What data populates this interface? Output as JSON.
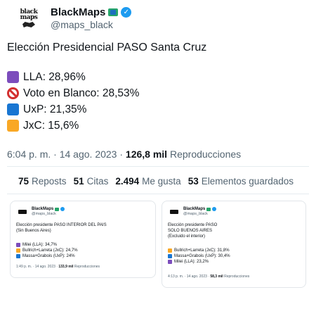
{
  "tweet": {
    "display_name": "BlackMaps",
    "handle": "@maps_black",
    "avatar_logo": "black maps",
    "title": "Elección Presidencial PASO Santa Cruz",
    "results": [
      {
        "label": "LLA: 28,96%",
        "color": "#7c4dbc",
        "icon": "purple-square-icon"
      },
      {
        "label": "Voto en Blanco: 28,53%",
        "color": "#d32f2f",
        "icon": "prohibited-icon"
      },
      {
        "label": "UxP: 21,35%",
        "color": "#1976d2",
        "icon": "blue-square-icon"
      },
      {
        "label": "JxC: 15,6%",
        "color": "#f9a825",
        "icon": "yellow-square-icon"
      }
    ],
    "time": "6:04 p. m.",
    "sep1": "·",
    "date": "14 ago. 2023",
    "sep2": "·",
    "views_count": "126,8 mil",
    "views_label": "Reproducciones"
  },
  "stats": [
    {
      "count": "75",
      "label": "Reposts"
    },
    {
      "count": "51",
      "label": "Citas"
    },
    {
      "count": "2.494",
      "label": "Me gusta"
    },
    {
      "count": "53",
      "label": "Elementos guardados"
    }
  ],
  "thumb_left": {
    "display_name": "BlackMaps",
    "handle": "@maps_black",
    "line1": "Elección presidente PASO INTERIOR DEL PAIS",
    "line2": "(Sin Buenos Aires)",
    "results": [
      {
        "label": "Milei (LLA): 34,7%",
        "color": "#7c4dbc"
      },
      {
        "label": "Bullrich+Larreta (JxC): 24,7%",
        "color": "#f9a825"
      },
      {
        "label": "Massa+Grabois (UxP): 24%",
        "color": "#1976d2"
      }
    ],
    "time": "1:49 p. m.",
    "date": "14 ago. 2023",
    "views_count": "133,9 mil",
    "views_label": "Reproducciones"
  },
  "thumb_right": {
    "display_name": "BlackMaps",
    "handle": "@maps_black",
    "line1": "Elección presidente PASO",
    "line2": "SOLO BUENOS AIRES",
    "line3": "(Excluido el interior)",
    "results": [
      {
        "label": "Bullrich+Larreta (JxC): 31,8%",
        "color": "#f9a825"
      },
      {
        "label": "Massa+Grabois (UxP): 30,4%",
        "color": "#1976d2"
      },
      {
        "label": "Milei (LLA): 23,2%",
        "color": "#7c4dbc"
      }
    ],
    "time": "4:13 p. m.",
    "date": "14 ago. 2023",
    "views_count": "58,3 mil",
    "views_label": "Reproducciones"
  }
}
